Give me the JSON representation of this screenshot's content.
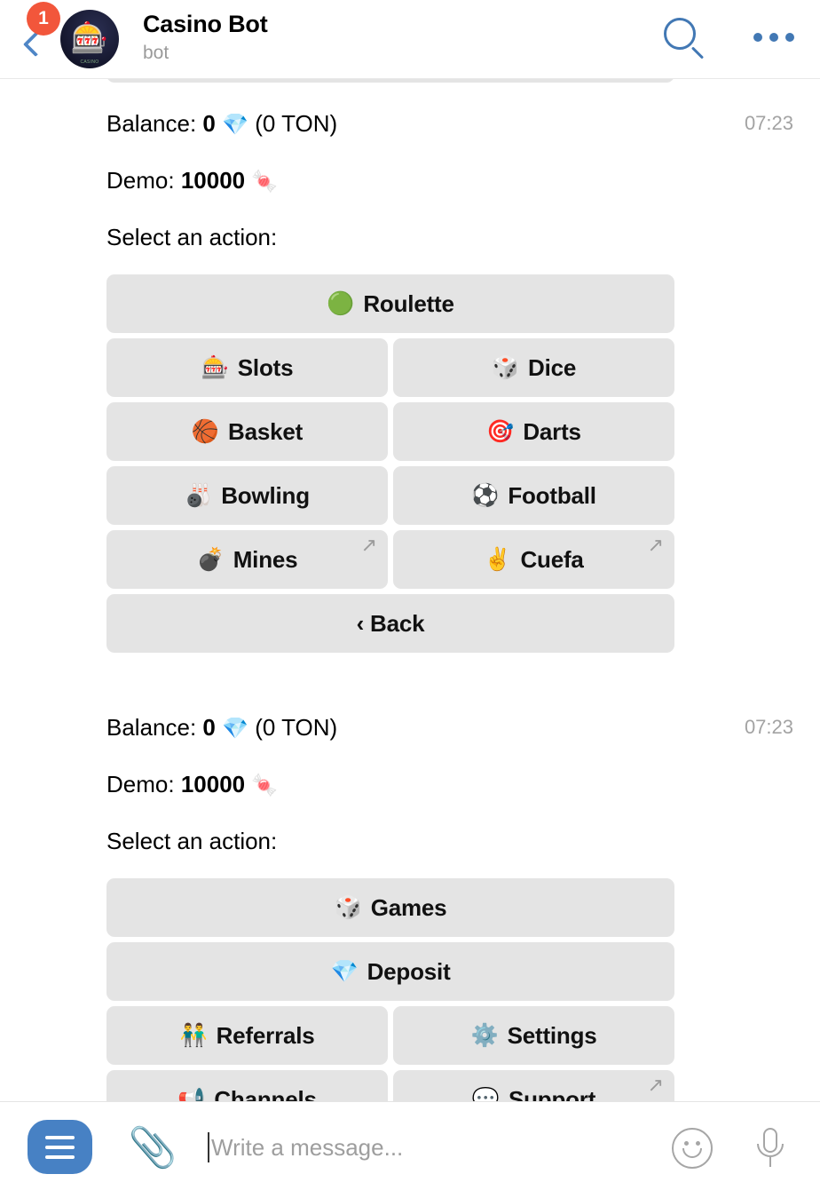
{
  "header": {
    "back_icon": "back-chevron-icon",
    "unread_badge": "1",
    "avatar_emoji": "🎰",
    "avatar_caption": "CASINO",
    "title": "Casino Bot",
    "status": "bot",
    "search_icon": "search-icon",
    "more_icon": "more-options-icon"
  },
  "messages": [
    {
      "time": "07:23",
      "lines": [
        {
          "prefix": "Balance: ",
          "value": "0",
          "emoji": "💎",
          "suffix": " (0 TON)"
        },
        {
          "prefix": "Demo: ",
          "value": "10000",
          "emoji": "🍬",
          "suffix": ""
        },
        {
          "prefix": "Select an action:",
          "value": "",
          "emoji": "",
          "suffix": ""
        }
      ],
      "keyboard": [
        [
          {
            "icon": "🟢",
            "label": "Roulette",
            "external": false
          }
        ],
        [
          {
            "icon": "🎰",
            "label": "Slots",
            "external": false
          },
          {
            "icon": "🎲",
            "label": "Dice",
            "external": false
          }
        ],
        [
          {
            "icon": "🏀",
            "label": "Basket",
            "external": false
          },
          {
            "icon": "🎯",
            "label": "Darts",
            "external": false
          }
        ],
        [
          {
            "icon": "🎳",
            "label": "Bowling",
            "external": false
          },
          {
            "icon": "⚽",
            "label": "Football",
            "external": false
          }
        ],
        [
          {
            "icon": "💣",
            "label": "Mines",
            "external": true
          },
          {
            "icon": "✌️",
            "label": "Cuefa",
            "external": true
          }
        ],
        [
          {
            "icon": "",
            "label": "‹ Back",
            "external": false
          }
        ]
      ]
    },
    {
      "time": "07:23",
      "lines": [
        {
          "prefix": "Balance: ",
          "value": "0",
          "emoji": "💎",
          "suffix": " (0 TON)"
        },
        {
          "prefix": "Demo: ",
          "value": "10000",
          "emoji": "🍬",
          "suffix": ""
        },
        {
          "prefix": "Select an action:",
          "value": "",
          "emoji": "",
          "suffix": ""
        }
      ],
      "keyboard": [
        [
          {
            "icon": "🎲",
            "label": "Games",
            "external": false
          }
        ],
        [
          {
            "icon": "💎",
            "label": "Deposit",
            "external": false
          }
        ],
        [
          {
            "icon": "👬",
            "label": "Referrals",
            "external": false
          },
          {
            "icon": "⚙️",
            "label": "Settings",
            "external": false
          }
        ],
        [
          {
            "icon": "📢",
            "label": "Channels",
            "external": false
          },
          {
            "icon": "💬",
            "label": "Support",
            "external": true
          }
        ]
      ]
    }
  ],
  "composer": {
    "menu_icon": "hamburger-menu-icon",
    "attach_icon": "paperclip-icon",
    "input_value": "",
    "input_placeholder": "Write a message...",
    "emoji_icon": "smiley-icon",
    "mic_icon": "microphone-icon"
  },
  "external_arrow_glyph": "↗",
  "colors": {
    "accent_blue": "#4781c4",
    "badge_red": "#f2563b",
    "button_gray": "#e4e4e4",
    "timestamp_gray": "#a3a3a3"
  }
}
